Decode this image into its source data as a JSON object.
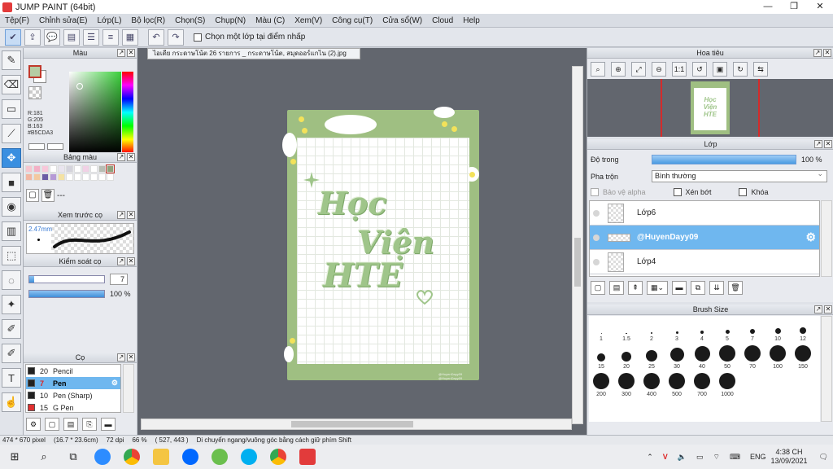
{
  "window": {
    "title": "JUMP PAINT (64bit)",
    "controls": [
      "—",
      "❐",
      "✕"
    ]
  },
  "menu": [
    "Tệp(F)",
    "Chỉnh sửa(E)",
    "Lớp(L)",
    "Bộ lọc(R)",
    "Chọn(S)",
    "Chụp(N)",
    "Màu (C)",
    "Xem(V)",
    "Công cụ(T)",
    "Cửa sổ(W)",
    "Cloud",
    "Help"
  ],
  "toolbar": {
    "single_layer_label": "Chọn một lớp tại điểm nhấp"
  },
  "color_panel": {
    "title": "Màu",
    "r": "R:181",
    "g": "G:205",
    "b": "B:163",
    "hex": "#B5CDA3",
    "fg_color": "#b5cda3"
  },
  "palette_panel": {
    "title": "Bảng màu",
    "dots": "---",
    "swatches": [
      "#f6c6cf",
      "#f3b0c6",
      "#f8c7da",
      "#ffffff",
      "#e9e5ef",
      "#d4d3dc",
      "#ffffff",
      "#f1d1e6",
      "#ffffff",
      "#b8bdb4",
      "#8fa27c",
      "#f2b6a2",
      "#f3c9a0",
      "#6b5ca5",
      "#b69ad6",
      "#f4e2a3",
      "#ffffff",
      "#ffffff",
      "#ffffff",
      "#ffffff",
      "#ffffff",
      "#ffffff"
    ]
  },
  "preview_panel": {
    "title": "Xem trước cọ",
    "size": "2.47mm"
  },
  "control_panel": {
    "title": "Kiểm soát cọ",
    "size_value": "7",
    "size_fill": 0.07,
    "opacity_label": "100 %",
    "opacity_fill": 1.0
  },
  "brush_panel": {
    "title": "Cọ",
    "items": [
      {
        "size": "20",
        "name": "Pencil",
        "color": "#222222"
      },
      {
        "size": "7",
        "name": "Pen",
        "color": "#222222"
      },
      {
        "size": "10",
        "name": "Pen (Sharp)",
        "color": "#222222"
      },
      {
        "size": "15",
        "name": "G Pen",
        "color": "#e03030"
      }
    ]
  },
  "document": {
    "tab": "ไอเดีย กระดาษโน้ต 26 รายการ _ กระดาษโน้ต, สมุดออร์แกไน (2).jpg",
    "line1": "Học",
    "line2": "Viện",
    "line3": "HTE",
    "credit1": "@HuyenDayy09",
    "credit2": "@HuyenDayy09"
  },
  "navigator": {
    "title": "Hoa tiêu"
  },
  "layer_panel": {
    "title": "Lớp",
    "opacity_label": "Độ trong",
    "opacity_value": "100 %",
    "blend_label": "Pha trộn",
    "blend_value": "Bình thường",
    "protect_alpha": "Bảo vệ alpha",
    "clip": "Xén bớt",
    "lock": "Khóa",
    "layers": [
      {
        "name": "Lớp6",
        "active": false
      },
      {
        "name": "@HuyenDayy09",
        "active": true
      },
      {
        "name": "Lớp4",
        "active": false
      }
    ]
  },
  "brush_size_panel": {
    "title": "Brush Size",
    "sizes": [
      "1",
      "1.5",
      "2",
      "3",
      "4",
      "5",
      "7",
      "10",
      "12",
      "15",
      "20",
      "25",
      "30",
      "40",
      "50",
      "70",
      "100",
      "150",
      "200",
      "300",
      "400",
      "500",
      "700",
      "1000"
    ]
  },
  "status": {
    "size": "474 * 670 pixel",
    "dims": "(16.7 * 23.6cm)",
    "dpi": "72 dpi",
    "zoom": "66 %",
    "coords": "( 527, 443 )",
    "hint": "Di chuyển ngang/vuông góc bằng cách giữ phím Shift"
  },
  "taskbar": {
    "lang": "ENG",
    "time": "4:38 CH",
    "date": "13/09/2021"
  }
}
